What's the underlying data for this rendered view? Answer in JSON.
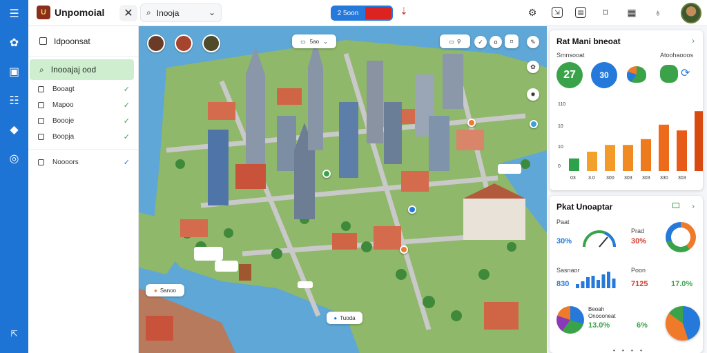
{
  "app": {
    "title": "Unpomoial",
    "logo_glyph": "U"
  },
  "topbar": {
    "close_glyph": "✕",
    "search_value": "Inooja",
    "search_placeholder": "Search",
    "pill_label": "2 5oon"
  },
  "sidebar": {
    "header": "Idpoonsat",
    "active": "Inooajaj ood",
    "items": [
      {
        "label": "Booagt",
        "check": "✓"
      },
      {
        "label": "Mapoo",
        "check": "✓"
      },
      {
        "label": "Boooje",
        "check": "✓"
      },
      {
        "label": "Boopja",
        "check": "✓"
      }
    ],
    "extra": {
      "label": "Noooors",
      "check": "✓"
    }
  },
  "map": {
    "chips": [
      {
        "label": "5ao"
      },
      {
        "label": "Sanoo"
      },
      {
        "label": "Tuoda"
      }
    ]
  },
  "card1": {
    "title": "Rat Mani bneoat",
    "label_left": "Smnsooat",
    "label_right": "Atoohaooos",
    "circle_a": "27",
    "circle_b": "30",
    "chart_data": {
      "type": "bar",
      "categories": [
        "03",
        "3.0",
        "300",
        "303",
        "303",
        "330",
        "303"
      ],
      "values": [
        13,
        20,
        27,
        27,
        33,
        48,
        42,
        62
      ],
      "yticks": [
        "0",
        "10",
        "10",
        "110"
      ],
      "ylim": [
        0,
        70
      ],
      "colors": [
        "#2ea24a",
        "#f2a12a",
        "#f29a2a",
        "#f08a22",
        "#ee7a1e",
        "#ec6c1c",
        "#e85a18",
        "#d94a12"
      ]
    }
  },
  "card2": {
    "title": "Pkat Unoaptar",
    "m1_label": "Paat",
    "m1_value": "30%",
    "m2_label": "Prad",
    "m2_value": "30%",
    "m3_label": "Sasnaor",
    "m3_value": "830",
    "m4_label": "Poon",
    "m4_value": "7125",
    "m5_value": "17.0%",
    "m6_label": "Beoah",
    "m6_sub": "Onoooneat",
    "m6_value": "13.0%",
    "m7_value": "6%",
    "spark_values": [
      3,
      5,
      8,
      9,
      6,
      10,
      12,
      7
    ]
  },
  "footer": {
    "dots": "• • • •"
  }
}
